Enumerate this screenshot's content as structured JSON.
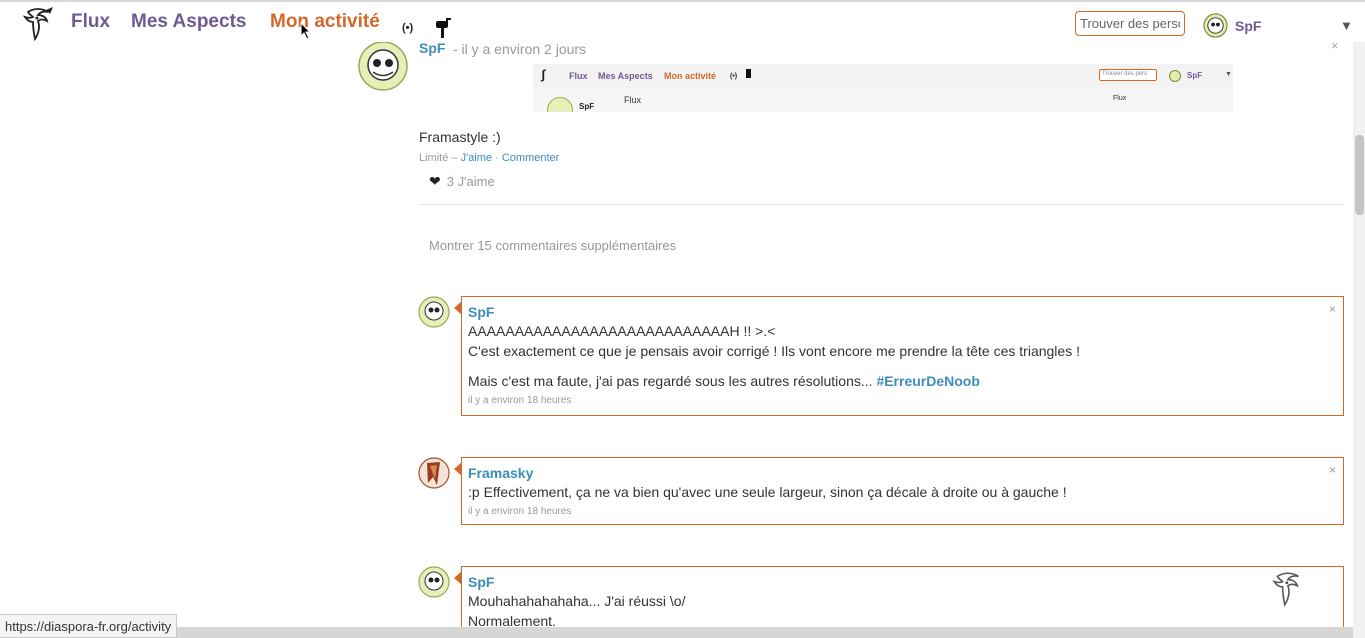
{
  "header": {
    "nav": [
      "Flux",
      "Mes Aspects",
      "Mon activité"
    ],
    "search_placeholder": "Trouver des personnes",
    "user_name": "SpF",
    "notifications_icon": "(•)"
  },
  "post": {
    "author": "SpF",
    "time": "- il y a environ 2 jours",
    "text": "Framastyle :)",
    "visibility": "Limité",
    "like_action": "J'aime",
    "comment_action": "Commenter",
    "likes": "3 J'aime",
    "more_comments": "Montrer 15 commentaires supplémentaires",
    "screenshot": {
      "nav": [
        "Flux",
        "Mes Aspects",
        "Mon activité"
      ],
      "search_placeholder": "Trouver des pers",
      "user": "SpF",
      "col_title": "Flux",
      "right_title": "Flux"
    }
  },
  "comments": [
    {
      "author": "SpF",
      "lines": [
        "AAAAAAAAAAAAAAAAAAAAAAAAAAAAH !! >.<",
        "C'est exactement ce que je pensais avoir corrigé ! Ils vont encore me prendre la tête ces triangles !"
      ],
      "line3": "Mais c'est ma faute, j'ai pas regardé sous les autres résolutions...",
      "hashtag": "#ErreurDeNoob",
      "time": "il y a environ 18 heures"
    },
    {
      "author": "Framasky",
      "lines": [
        ":p Effectivement, ça ne va bien qu'avec une seule largeur, sinon ça décale à droite ou à gauche !"
      ],
      "time": "il y a environ 18 heures"
    },
    {
      "author": "SpF",
      "lines": [
        "Mouhahahahahaha... J'ai réussi \\o/",
        "Normalement."
      ]
    }
  ],
  "close_glyph": "×",
  "status_url": "https://diaspora-fr.org/activity",
  "colors": {
    "accent": "#d4682b",
    "brand": "#6f5a94",
    "link": "#3b8dbd"
  }
}
